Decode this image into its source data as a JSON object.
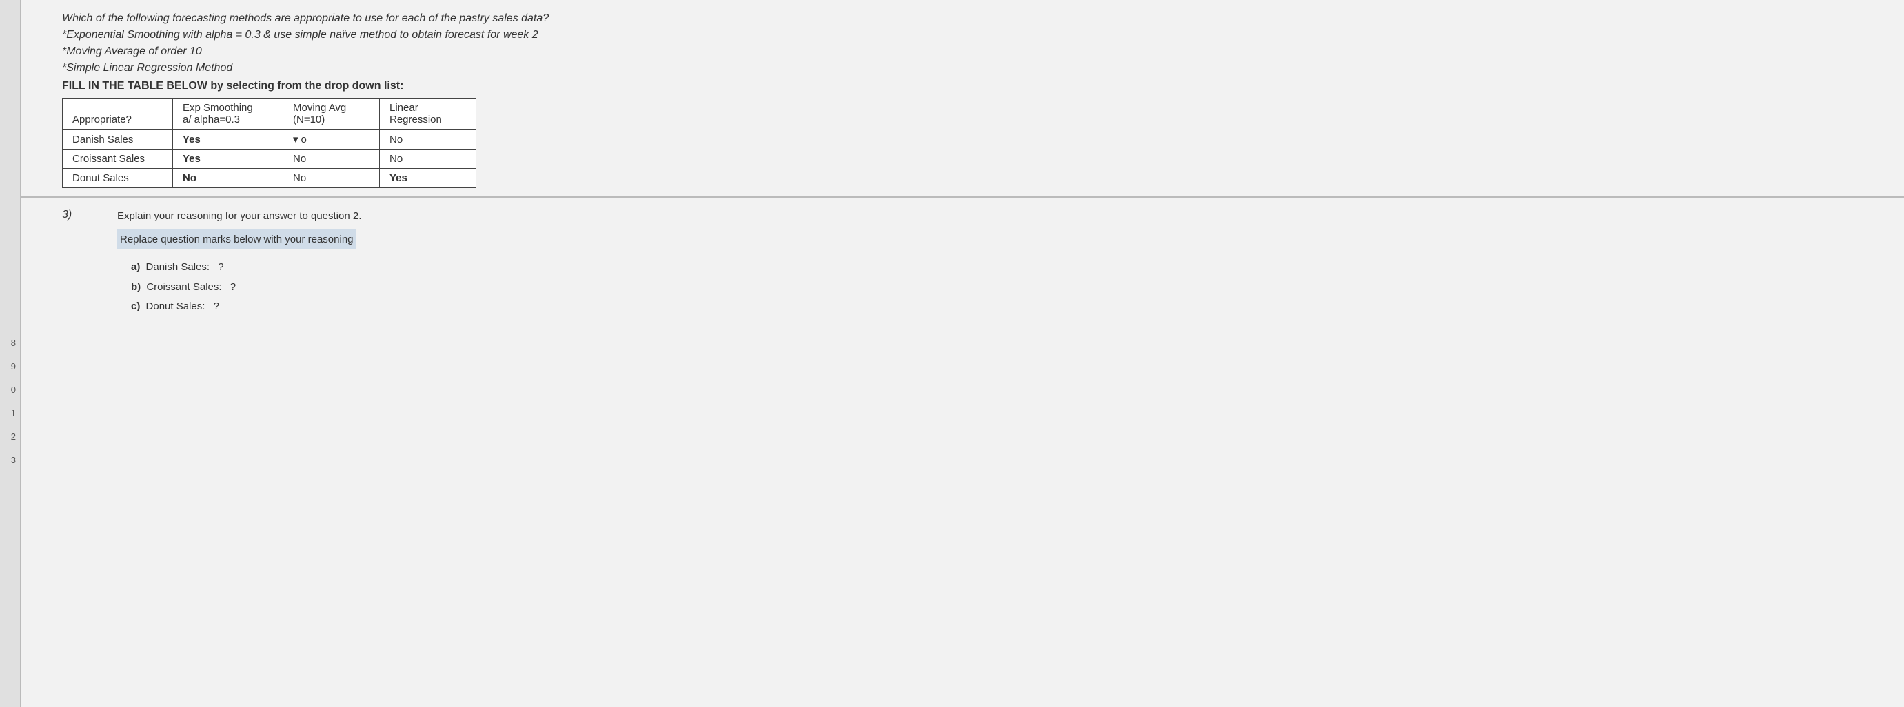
{
  "page": {
    "left_numbers": [
      "8",
      "9",
      "0",
      "1",
      "2",
      "3"
    ],
    "top_section": {
      "question_line1": "Which of the following forecasting methods are appropriate to use for each of the pastry sales data?",
      "question_line2": "*Exponential Smoothing with alpha = 0.3 & use simple naïve method to obtain forecast for week 2",
      "question_line3": "*Moving Average of order 10",
      "question_line4": "*Simple Linear Regression Method",
      "instruction": "FILL IN THE TABLE BELOW by selecting from the drop down list:",
      "table": {
        "headers": {
          "col0": "Appropriate?",
          "col1_line1": "Exp Smoothing",
          "col1_line2": "a/ alpha=0.3",
          "col2_line1": "Moving Avg",
          "col2_line2": "(N=10)",
          "col3_line1": "Linear",
          "col3_line2": "Regression"
        },
        "rows": [
          {
            "label": "Danish Sales",
            "exp_smoothing": "Yes",
            "moving_avg": "o",
            "linear_reg": "No"
          },
          {
            "label": "Croissant Sales",
            "exp_smoothing": "Yes",
            "moving_avg": "No",
            "linear_reg": "No"
          },
          {
            "label": "Donut Sales",
            "exp_smoothing": "No",
            "moving_avg": "No",
            "linear_reg": "Yes"
          }
        ]
      }
    },
    "bottom_section": {
      "question_number": "3)",
      "line1": "Explain your reasoning for your answer to question 2.",
      "line2": "Replace question marks below with your reasoning",
      "items": [
        {
          "label": "a)",
          "text": "Danish Sales:",
          "value": "?"
        },
        {
          "label": "b)",
          "text": "Croissant Sales:",
          "value": "?"
        },
        {
          "label": "c)",
          "text": "Donut Sales:",
          "value": "?"
        }
      ]
    }
  }
}
